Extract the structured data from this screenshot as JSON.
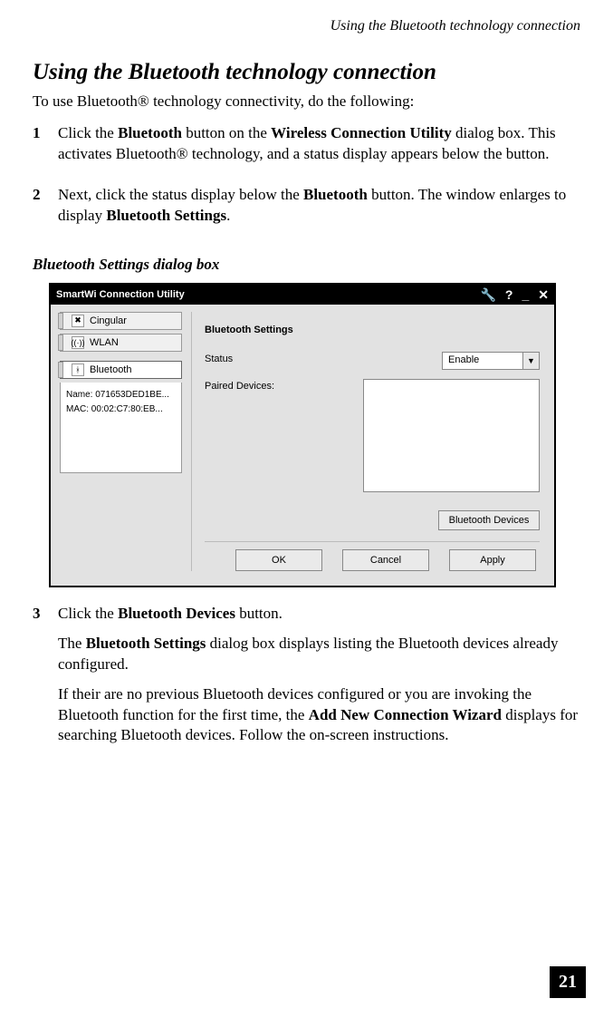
{
  "header": {
    "running": "Using the Bluetooth technology connection"
  },
  "title": "Using the Bluetooth technology connection",
  "intro": "To use Bluetooth® technology connectivity, do the following:",
  "steps": {
    "s1": {
      "num": "1",
      "p1a": "Click the ",
      "p1b": "Bluetooth",
      "p1c": " button on the ",
      "p1d": "Wireless Connection Utility",
      "p1e": " dialog box. This activates Bluetooth® technology, and a status display appears below the button."
    },
    "s2": {
      "num": "2",
      "p1a": "Next, click the status display below the ",
      "p1b": "Bluetooth",
      "p1c": " button. The window enlarges to display ",
      "p1d": "Bluetooth Settings",
      "p1e": "."
    },
    "s3": {
      "num": "3",
      "p1a": "Click the ",
      "p1b": "Bluetooth Devices",
      "p1c": " button.",
      "p2a": "The ",
      "p2b": "Bluetooth Settings",
      "p2c": " dialog box displays listing the Bluetooth devices already configured.",
      "p3a": "If their are no previous Bluetooth devices configured or you are invoking the Bluetooth function for the first time, the ",
      "p3b": "Add New Connection Wizard",
      "p3c": " displays for searching Bluetooth devices. Follow the on-screen instructions."
    }
  },
  "caption": "Bluetooth Settings dialog box",
  "dialog": {
    "title": "SmartWi Connection Utility",
    "side": {
      "cingular": "Cingular",
      "wlan": "WLAN",
      "bluetooth": "Bluetooth",
      "status_name": "Name: 071653DED1BE...",
      "status_mac": "MAC:  00:02:C7:80:EB..."
    },
    "panel": {
      "title": "Bluetooth Settings",
      "status_label": "Status",
      "paired_label": "Paired Devices:",
      "status_value": "Enable",
      "bt_devices_button": "Bluetooth Devices",
      "ok": "OK",
      "cancel": "Cancel",
      "apply": "Apply"
    }
  },
  "page_number": "21"
}
